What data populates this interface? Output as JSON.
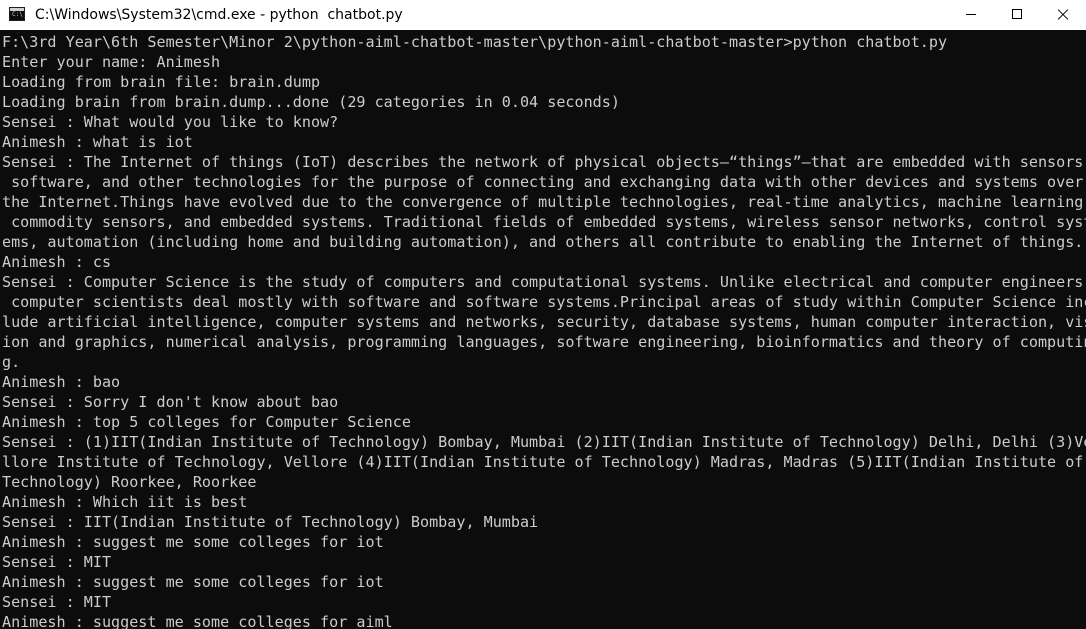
{
  "window": {
    "title": "C:\\Windows\\System32\\cmd.exe - python  chatbot.py",
    "icon": "cmd-icon",
    "icon_glyph": "C:\\"
  },
  "console": {
    "lines": [
      "F:\\3rd Year\\6th Semester\\Minor 2\\python-aiml-chatbot-master\\python-aiml-chatbot-master>python chatbot.py",
      "Enter your name: Animesh",
      "Loading from brain file: brain.dump",
      "Loading brain from brain.dump...done (29 categories in 0.04 seconds)",
      "Sensei : What would you like to know?",
      "Animesh : what is iot",
      "Sensei : The Internet of things (IoT) describes the network of physical objects—“things”—that are embedded with sensors,",
      " software, and other technologies for the purpose of connecting and exchanging data with other devices and systems over",
      "the Internet.Things have evolved due to the convergence of multiple technologies, real-time analytics, machine learning,",
      " commodity sensors, and embedded systems. Traditional fields of embedded systems, wireless sensor networks, control syst",
      "ems, automation (including home and building automation), and others all contribute to enabling the Internet of things.",
      "Animesh : cs",
      "Sensei : Computer Science is the study of computers and computational systems. Unlike electrical and computer engineers,",
      " computer scientists deal mostly with software and software systems.Principal areas of study within Computer Science inc",
      "lude artificial intelligence, computer systems and networks, security, database systems, human computer interaction, vis",
      "ion and graphics, numerical analysis, programming languages, software engineering, bioinformatics and theory of computin",
      "g.",
      "Animesh : bao",
      "Sensei : Sorry I don't know about bao",
      "Animesh : top 5 colleges for Computer Science",
      "Sensei : (1)IIT(Indian Institute of Technology) Bombay, Mumbai (2)IIT(Indian Institute of Technology) Delhi, Delhi (3)Ve",
      "llore Institute of Technology, Vellore (4)IIT(Indian Institute of Technology) Madras, Madras (5)IIT(Indian Institute of",
      "Technology) Roorkee, Roorkee",
      "Animesh : Which iit is best",
      "Sensei : IIT(Indian Institute of Technology) Bombay, Mumbai",
      "Animesh : suggest me some colleges for iot",
      "Sensei : MIT",
      "Animesh : suggest me some colleges for iot",
      "Sensei : MIT",
      "Animesh : suggest me some colleges for aiml"
    ]
  }
}
